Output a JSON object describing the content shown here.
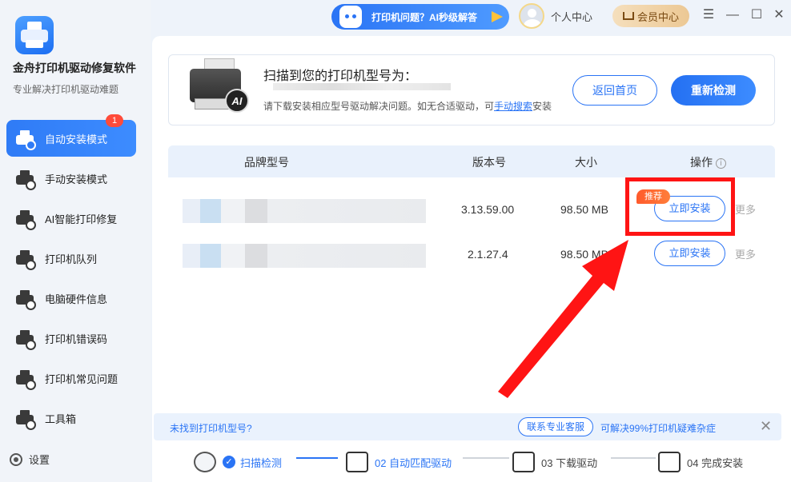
{
  "app": {
    "title": "金舟打印机驱动修复软件",
    "subtitle": "专业解决打印机驱动难题"
  },
  "sidebar": {
    "items": [
      {
        "label": "自动安装模式",
        "badge": "1",
        "icon": "auto-install-icon"
      },
      {
        "label": "手动安装模式",
        "icon": "manual-install-icon"
      },
      {
        "label": "AI智能打印修复",
        "icon": "ai-repair-icon"
      },
      {
        "label": "打印机队列",
        "icon": "printer-queue-icon"
      },
      {
        "label": "电脑硬件信息",
        "icon": "hardware-info-icon"
      },
      {
        "label": "打印机错误码",
        "icon": "error-code-icon"
      },
      {
        "label": "打印机常见问题",
        "icon": "faq-icon"
      },
      {
        "label": "工具箱",
        "icon": "toolbox-icon"
      }
    ],
    "settings_label": "设置"
  },
  "topbar": {
    "ai_banner": "打印机问题？AI秒级解答",
    "user_center": "个人中心",
    "vip_center": "会员中心",
    "menu_glyph": "☰",
    "minimize_glyph": "—",
    "maximize_glyph": "☐",
    "close_glyph": "✕"
  },
  "scan": {
    "title": "扫描到您的打印机型号为：",
    "hint_prefix": "请下载安装相应型号驱动解决问题。如无合适驱动，可",
    "hint_link": "手动搜索",
    "hint_suffix": "安装",
    "back_button": "返回首页",
    "rescan_button": "重新检测",
    "printer_badge": "AI"
  },
  "table": {
    "headers": [
      "品牌型号",
      "版本号",
      "大小",
      "操作"
    ],
    "info_glyph": "i",
    "rows": [
      {
        "version": "3.13.59.00",
        "size": "98.50 MB",
        "action": "立即安装",
        "more": "更多",
        "recommended": true
      },
      {
        "version": "2.1.27.4",
        "size": "98.50 MB",
        "action": "立即安装",
        "more": "更多",
        "recommended": false
      }
    ],
    "recommend_tag": "推荐"
  },
  "notice": {
    "left": "未找到打印机型号?",
    "button": "联系专业客服",
    "right": "可解决99%打印机疑难杂症",
    "close_glyph": "✕"
  },
  "steps": [
    {
      "label": "扫描检测",
      "state": "done",
      "check_glyph": "✓"
    },
    {
      "label": "02 自动匹配驱动",
      "state": "active"
    },
    {
      "label": "03 下载驱动",
      "state": "pending"
    },
    {
      "label": "04 完成安装",
      "state": "pending"
    }
  ],
  "colors": {
    "accent": "#2a74f5",
    "annotation": "#ff1414",
    "badge": "#ff4b3a",
    "recommend": "#ff5a2c"
  }
}
